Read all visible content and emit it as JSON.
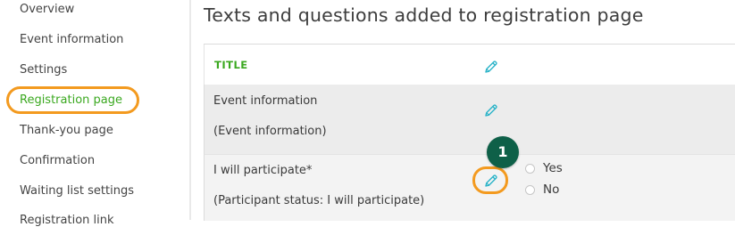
{
  "sidebar": {
    "items": [
      {
        "label": "Overview"
      },
      {
        "label": "Event information"
      },
      {
        "label": "Settings"
      },
      {
        "label": "Registration page",
        "active": true
      },
      {
        "label": "Thank-you page"
      },
      {
        "label": "Confirmation"
      },
      {
        "label": "Waiting list settings"
      },
      {
        "label": "Registration link"
      }
    ]
  },
  "main": {
    "title": "Texts and questions added to registration page",
    "rows": [
      {
        "label": "TITLE"
      },
      {
        "label": "Event information",
        "sublabel": "(Event information)"
      },
      {
        "label": "I will participate*",
        "sublabel": "(Participant status: I will participate)",
        "options": [
          "Yes",
          "No"
        ]
      }
    ]
  },
  "annotation": {
    "step": "1"
  },
  "colors": {
    "accent_green": "#3aa81f",
    "highlight_orange": "#f39a1f",
    "badge_green": "#0e6048",
    "pencil_blue": "#2ab3c8"
  },
  "icons": {
    "edit": "pencil-icon"
  }
}
